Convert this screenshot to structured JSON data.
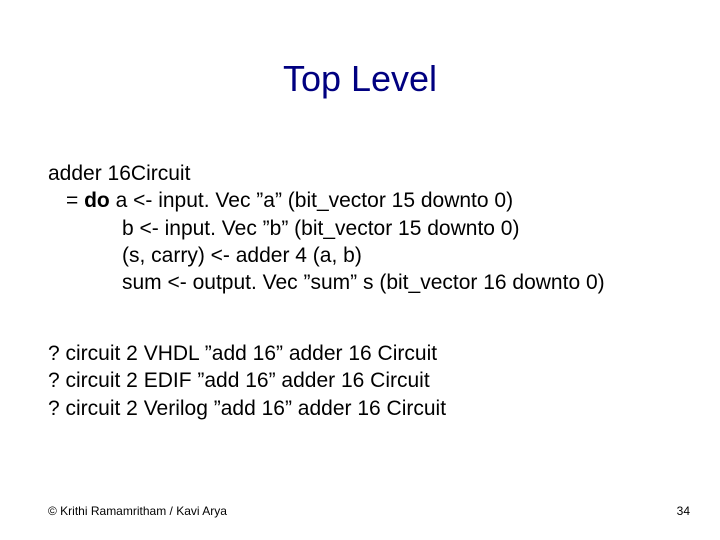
{
  "title": "Top Level",
  "code": {
    "line1": "adder 16Circuit",
    "line2_prefix": "= ",
    "line2_do": "do",
    "line2_rest": " a <- input. Vec ”a” (bit_vector 15 downto 0)",
    "line3": "b <- input. Vec ”b” (bit_vector 15 downto 0)",
    "line4": "(s, carry) <- adder 4 (a, b)",
    "line5": "sum <- output. Vec ”sum” s (bit_vector 16 downto 0)"
  },
  "calls": {
    "line1": "? circuit 2 VHDL ”add 16” adder 16 Circuit",
    "line2": "? circuit 2 EDIF ”add 16” adder 16 Circuit",
    "line3": "? circuit 2 Verilog ”add 16” adder 16 Circuit"
  },
  "footer": "© Krithi Ramamritham / Kavi Arya",
  "pagenum": "34"
}
